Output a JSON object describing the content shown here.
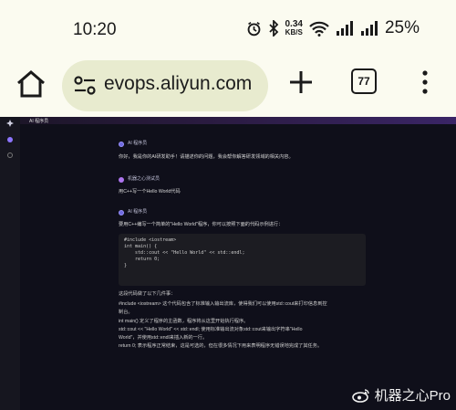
{
  "status_bar": {
    "time": "10:20",
    "net_speed_value": "0.34",
    "net_speed_unit": "KB/S",
    "battery": "25%"
  },
  "browser": {
    "url": "evops.aliyun.com",
    "tab_count": "77"
  },
  "app": {
    "title": "AI 程序员"
  },
  "chat": {
    "ai_name": "AI 程序员",
    "greeting": "你好，我是你的AI研发助手！请描述你的问题，我会帮你解答研发领域的相关内容。",
    "user_name": "机器之心测试员",
    "user_message": "用C++写一个Hello World代码",
    "ai_intro": "要用C++编写一个简单的\"Hello World\"程序，你可以按照下面的代码示例进行：",
    "code_lines": [
      "#include <iostream>",
      "",
      "int main() {",
      "    std::cout << \"Hello World\" << std::endl;",
      "    return 0;",
      "}"
    ],
    "explain_intro": "这段代码做了以下几件事：",
    "explain_lines": [
      "#include <iostream> 这个代码包含了标准输入输出流库，使得我们可以使用std::cout来打印信息到控",
      "制台。",
      "int main() 定义了程序的主函数，程序将从这里开始执行程序。",
      "std::cout << \"Hello World\" << std::endl; 使用标准输出流对象std::cout来输出字符串\"Hello",
      "World\"，并使用std::endl来插入新的一行。",
      "return 0; 表示程序正常结束，这是可选的，但在很多情况下用来表明程序无错误地完成了其任务。"
    ]
  },
  "watermark": "机器之心Pro"
}
